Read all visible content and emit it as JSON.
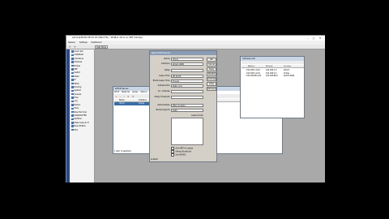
{
  "app": {
    "title": "admin@38:6C:0E:XX:XX (MikroTik) - WinBox v6.xx on hEX (mmips)"
  },
  "menubar": {
    "items": [
      "Session",
      "Settings",
      "Dashboard"
    ]
  },
  "toolbar": {
    "safe_mode": "Safe Mode"
  },
  "sidebar": {
    "items": [
      "Quick Set",
      "CAPsMAN",
      "Interfaces",
      "Wireless",
      "Bridge",
      "PPP",
      "Switch",
      "Mesh",
      "IP",
      "MPLS",
      "Routing",
      "System",
      "Queues",
      "Files",
      "Log",
      "Radius",
      "Tools",
      "New Terminal",
      "MetaROUTER",
      "Partition",
      "Make Supout.rif",
      "New WinBox",
      "Exit"
    ]
  },
  "dhcp_server_window": {
    "title": "DHCP Server",
    "tabs": [
      "DHCP",
      "Networks",
      "Leases",
      "Options",
      "Option Sets",
      "Alerts"
    ],
    "columns": [
      "Name",
      "Interface"
    ],
    "rows": [
      [
        "dhcp1",
        "bridge"
      ]
    ],
    "status": "1 item (1 selected)"
  },
  "dhcp_dialog": {
    "title": "New DHCP Server",
    "fields": [
      {
        "label": "Name:",
        "value": "dhcp1"
      },
      {
        "label": "Interface:",
        "value": "ether1-WAN"
      },
      {
        "label": "Relay:",
        "value": ""
      },
      {
        "label": "Lease Time:",
        "value": "00:10:00"
      },
      {
        "label": "Bootp Lease Time:",
        "value": "forever"
      },
      {
        "label": "Address Pool:",
        "value": "static-only"
      },
      {
        "label": "Src. Address:",
        "value": ""
      },
      {
        "label": "Delay Threshold:",
        "value": ""
      },
      {
        "label": "Authoritative:",
        "value": "after 2s delay"
      },
      {
        "label": "Bootp Support:",
        "value": "static"
      }
    ],
    "lease_script_label": "Lease Script:",
    "buttons": [
      "OK",
      "Cancel",
      "Apply",
      "Disable",
      "Comment",
      "Copy",
      "Remove"
    ],
    "checkboxes": [
      "Add ARP For Leases",
      "Always Broadcast",
      "Use RADIUS"
    ],
    "status": "enabled"
  },
  "addr_window": {
    "title": "Address List",
    "columns": [
      "Address",
      "Network",
      "Interface"
    ],
    "rows": [
      [
        "192.168.1.1/24",
        "192.168.1.0",
        "ether1"
      ],
      [
        "192.168.2.1/24",
        "192.168.2.0",
        "bridge"
      ],
      [
        "192.168.88.1/24",
        "192.168.88.0",
        "ether1-WAN"
      ]
    ]
  },
  "colors": {
    "background": "#000000",
    "workspace": "#a9a9a9",
    "title_active": "#8a9db5",
    "window_face": "#d4d0c8",
    "selection": "#3a6ea5"
  }
}
